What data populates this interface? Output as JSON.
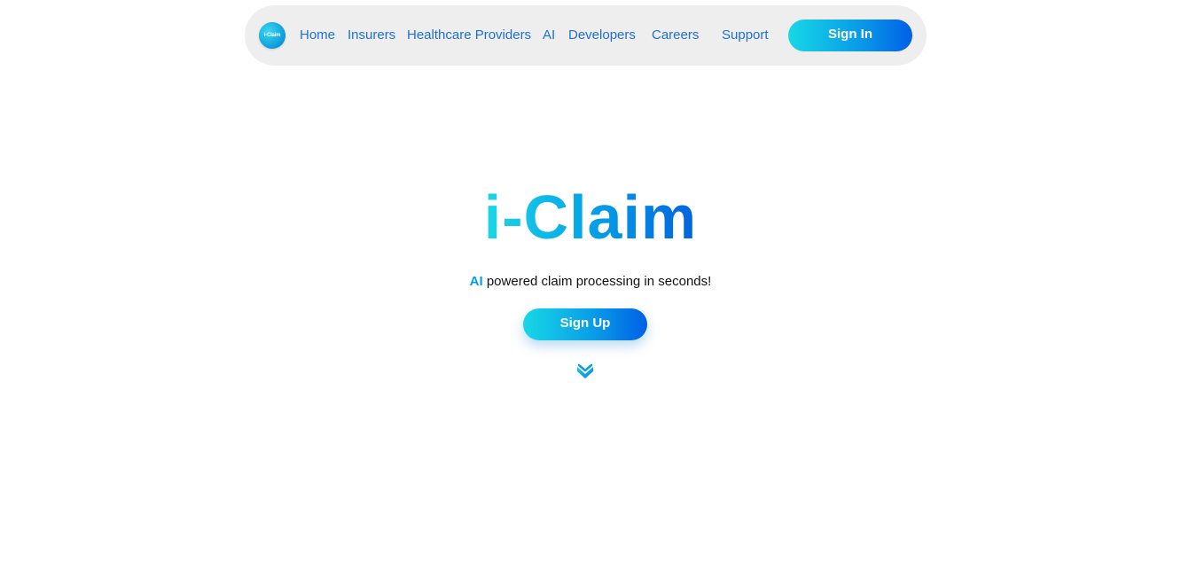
{
  "nav": {
    "logo_text": "i-Claim",
    "links": [
      {
        "label": "Home"
      },
      {
        "label": "Insurers"
      },
      {
        "label": "Healthcare Providers"
      },
      {
        "label": "AI"
      },
      {
        "label": "Developers"
      },
      {
        "label": "Careers"
      },
      {
        "label": "Support"
      }
    ],
    "signin_label": "Sign In"
  },
  "hero": {
    "title": "i-Claim",
    "tagline_highlight": "AI",
    "tagline_rest": " powered claim processing in seconds!",
    "signup_label": "Sign Up",
    "scroll_icon": "chevron-down-icon"
  },
  "colors": {
    "accent_start": "#17d8e6",
    "accent_end": "#0060e6",
    "nav_link": "#1f6fd6",
    "nav_bg": "#eeeeee"
  }
}
